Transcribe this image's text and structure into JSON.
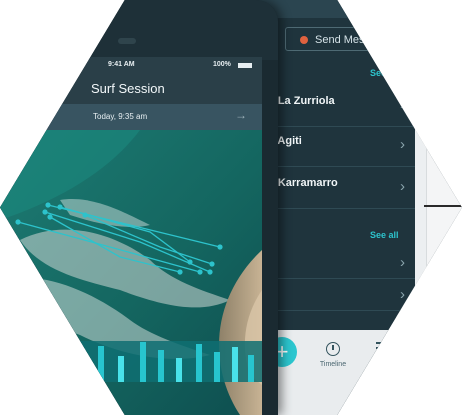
{
  "front_screen": {
    "status_time": "9:41 AM",
    "status_battery": "100%",
    "title": "Surf Session",
    "session_date": "Today, 9:35 am",
    "arrow": "→"
  },
  "back_screen": {
    "send_message_label": "Send Message",
    "see_all_top": "See all",
    "see_all_bottom": "See all",
    "sessions": [
      {
        "title": "at La Zurriola",
        "sub": "••"
      },
      {
        "title": "at Agiti",
        "sub": "••"
      },
      {
        "title": "at Karramarro",
        "sub": "••"
      }
    ],
    "chevron": "›",
    "fab_label": "+",
    "tabs": {
      "timeline": "Timeline",
      "more": "Mo"
    }
  },
  "colors": {
    "accent": "#2dc3cc",
    "ocean_deep": "#0f5a5a",
    "ocean_mid": "#1e7d76",
    "sand": "#bca687",
    "foam": "#c9d4d0"
  }
}
